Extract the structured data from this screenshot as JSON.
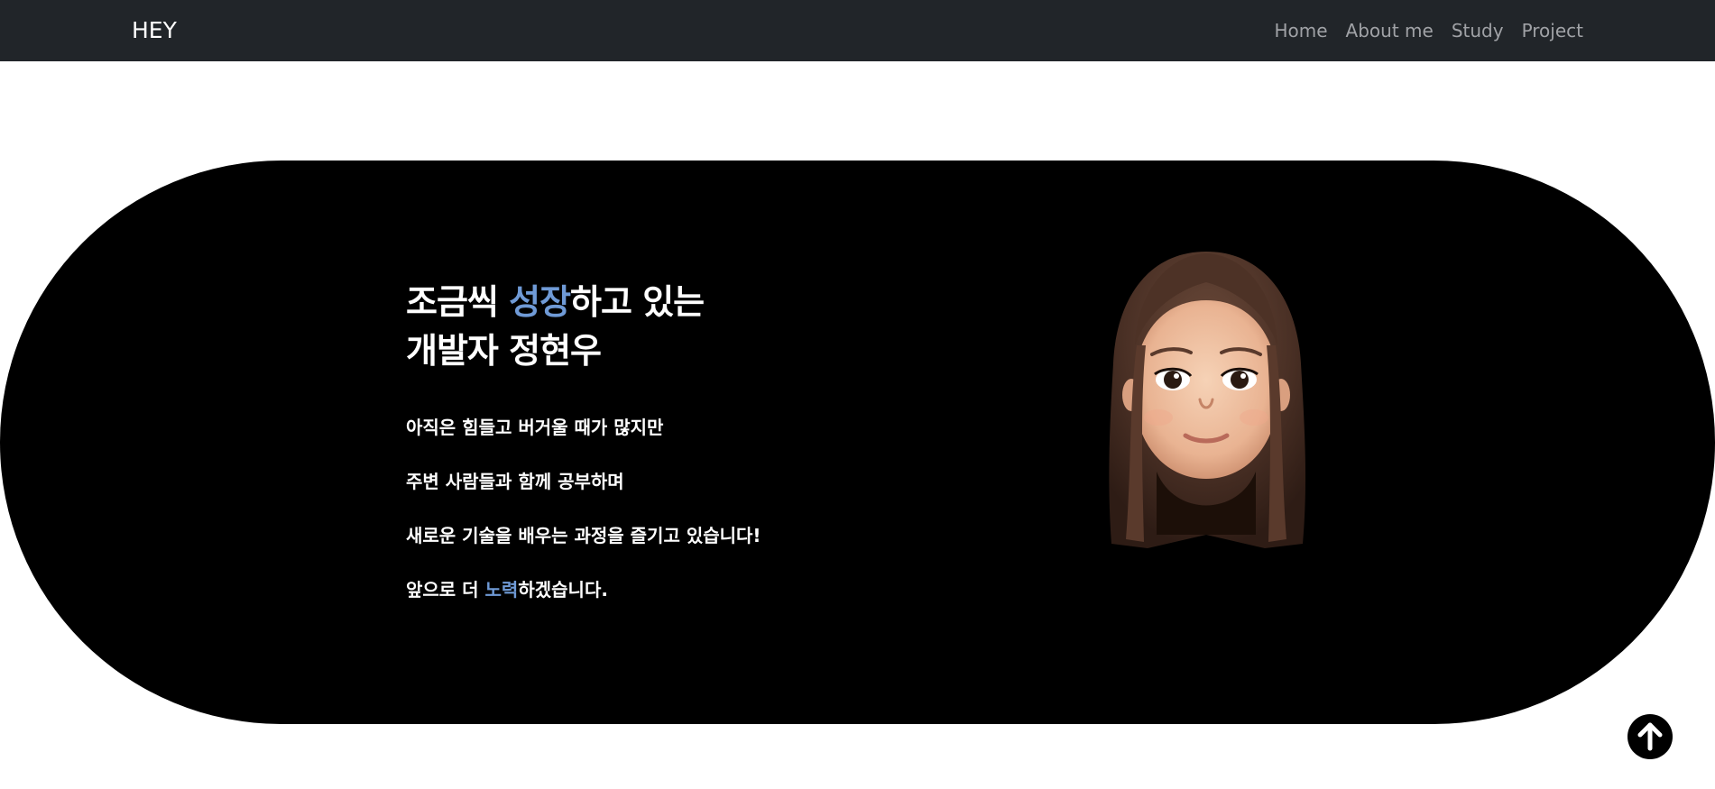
{
  "navbar": {
    "brand": "HEY",
    "links": [
      "Home",
      "About me",
      "Study",
      "Project"
    ]
  },
  "hero": {
    "headline_line1_pre": "조금씩 ",
    "headline_line1_accent": "성장",
    "headline_line1_post": "하고 있는",
    "headline_line2": "개발자 정현우",
    "p1": "아직은 힘들고 버거울 때가 많지만",
    "p2": "주변 사람들과 함께 공부하며",
    "p3": "새로운 기술을 배우는 과정을 즐기고 있습니다!",
    "p4_pre": "앞으로 더 ",
    "p4_accent": "노력",
    "p4_post": "하겠습니다."
  },
  "colors": {
    "navbar_bg": "#212529",
    "accent": "#6f9ad6",
    "hero_bg": "#000000"
  },
  "icons": {
    "avatar": "memoji-avatar",
    "scroll_top": "arrow-up-icon"
  }
}
